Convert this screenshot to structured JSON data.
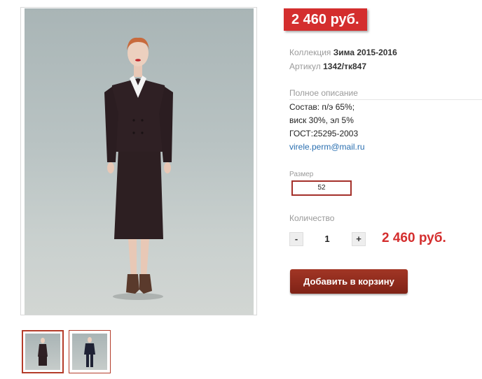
{
  "product": {
    "price_badge": "2 460 руб.",
    "collection_label": "Коллекция",
    "collection_value": "Зима 2015-2016",
    "article_label": "Артикул",
    "article_value": "1342/тк847",
    "description_title": "Полное описание",
    "description_lines": [
      "Состав: п/э 65%;",
      "виск 30%, эл 5%",
      "ГОСТ:25295-2003"
    ],
    "email": "virele.perm@mail.ru",
    "size_label": "Размер",
    "size_value": "52",
    "quantity_label": "Количество",
    "qty_minus": "-",
    "qty_value": "1",
    "qty_plus": "+",
    "total_price": "2 460 руб.",
    "add_to_cart": "Добавить в корзину"
  },
  "colors": {
    "accent_red": "#d42e2e",
    "button_brown": "#8f2b1d",
    "link_blue": "#2a6fb0"
  }
}
